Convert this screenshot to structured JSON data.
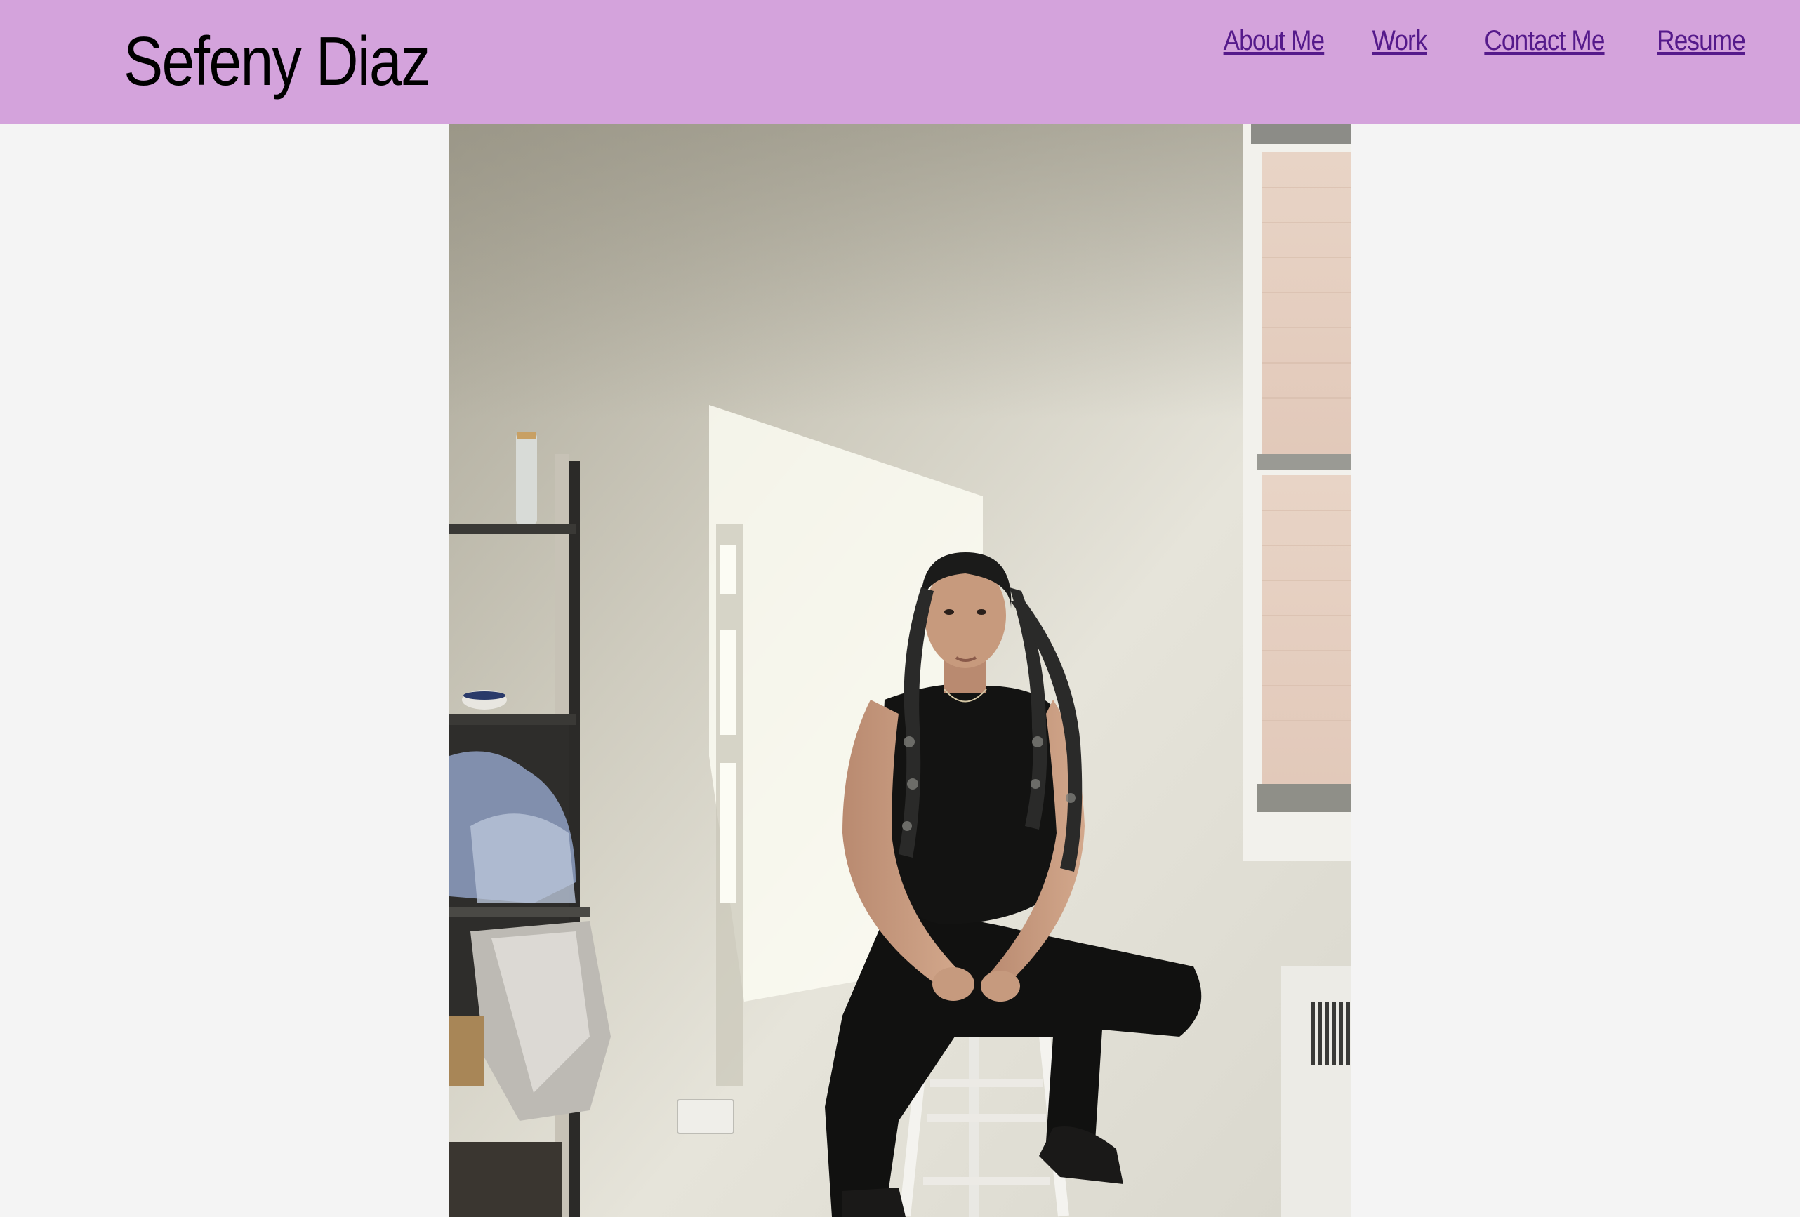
{
  "header": {
    "title": "Sefeny Diaz",
    "background_color": "#d4a3dc"
  },
  "nav": {
    "links": [
      {
        "label": "About Me"
      },
      {
        "label": "Work"
      },
      {
        "label": "Contact Me"
      },
      {
        "label": "Resume"
      }
    ],
    "link_color": "#551a8b"
  },
  "main": {
    "photo": {
      "subject": "portrait of a woman with long braids seated on a stool in a sunlit room",
      "icon": "portrait-photo"
    }
  },
  "page": {
    "background_color": "#f4f4f4"
  }
}
